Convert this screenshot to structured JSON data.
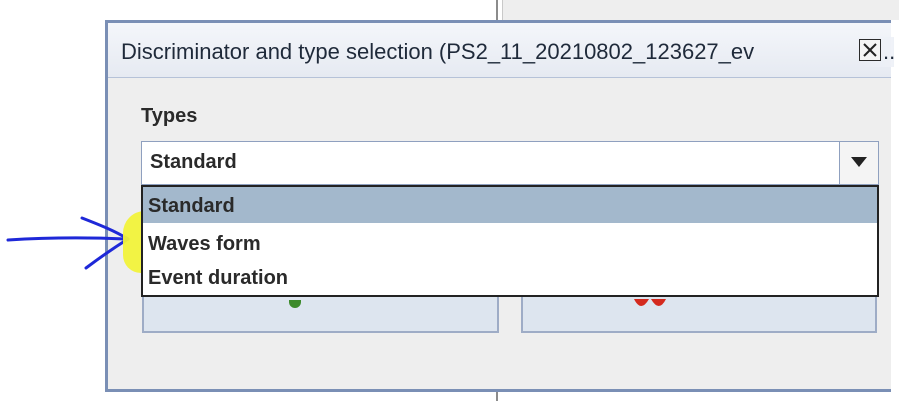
{
  "dialog": {
    "title": "Discriminator and type selection (PS2_11_20210802_123627_ev",
    "title_overflow": "..",
    "close_icon": "close-icon"
  },
  "types": {
    "label": "Types",
    "selected": "Standard",
    "dropdown_icon": "chevron-down-icon",
    "options": [
      "Standard",
      "Waves form",
      "Event duration"
    ]
  },
  "annotation": {
    "highlight_color": "#f1f23a",
    "arrow_color": "#1e28d8"
  }
}
